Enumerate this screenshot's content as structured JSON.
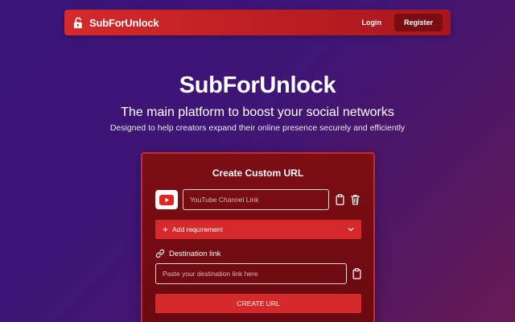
{
  "navbar": {
    "brand": "SubForUnlock",
    "brand_icon": "lock-open-icon",
    "login_label": "Login",
    "register_label": "Register"
  },
  "hero": {
    "title": "SubForUnlock",
    "subtitle": "The main platform to boost your social networks",
    "tagline": "Designed to help creators expand their online presence securely and efficiently"
  },
  "card": {
    "title": "Create Custom URL",
    "youtube_input": {
      "placeholder": "YouTube Channel Link",
      "value": ""
    },
    "add_requirement_label": "Add requirement",
    "destination_label": "Destination link",
    "destination_input": {
      "placeholder": "Paste your destination link here",
      "value": ""
    },
    "create_button_label": "CREATE URL"
  },
  "colors": {
    "navbar": "#c81f25",
    "register": "#7a0d12",
    "card": "#720c12",
    "card_border": "#c62a2a",
    "accent_button": "#d5292c",
    "youtube_red": "#e3241f"
  }
}
